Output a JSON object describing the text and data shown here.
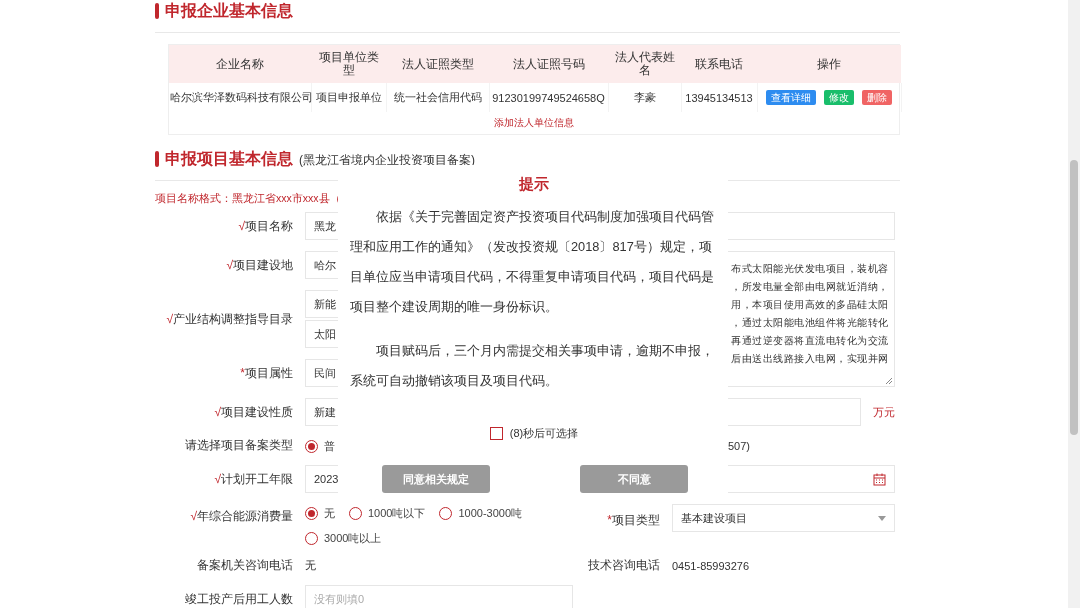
{
  "enterprise": {
    "title": "申报企业基本信息",
    "table": {
      "columns": [
        "企业名称",
        "项目单位类型",
        "法人证照类型",
        "法人证照号码",
        "法人代表姓名",
        "联系电话",
        "操作"
      ],
      "rows": [
        {
          "cells": [
            "哈尔滨华泽数码科技有限公司",
            "项目申报单位",
            "统一社会信用代码",
            "91230199749524658Q",
            "李豪",
            "13945134513"
          ],
          "actions": [
            {
              "label": "查看详细",
              "color": "#2d8cf0"
            },
            {
              "label": "修改",
              "color": "#19be6b"
            },
            {
              "label": "删除",
              "color": "#f06464"
            }
          ]
        }
      ],
      "add_link": "添加法人单位信息"
    }
  },
  "project": {
    "title": "申报项目基本信息",
    "subtitle": "(黑龙江省境内企业投资项目备案)",
    "hint": "项目名称格式：黑龙江省xxx市xxx县（",
    "description": {
      "lines": [
        "布式太阳能光伏发电项目，装机容",
        "，所发电量全部由电网就近消纳，",
        "用，本项目使用高效的多晶硅太阳",
        "，通过太阳能电池组件将光能转化",
        "再通过逆变器将直流电转化为交流",
        "后由送出线路接入电网，实现并网"
      ]
    },
    "rows": [
      {
        "mark": "√",
        "label": "项目名称",
        "kind": "wide_input",
        "value": "黑龙"
      },
      {
        "mark": "√",
        "label": "项目建设地",
        "kind": "input",
        "value": "哈尔"
      },
      {
        "mark": "√",
        "label": "产业结构调整指导目录",
        "kind": "double",
        "values": [
          "新能",
          "太阳"
        ]
      },
      {
        "mark": "*",
        "label": "项目属性",
        "kind": "input",
        "value": "民间"
      },
      {
        "mark": "√",
        "label": "项目建设性质",
        "kind": "input",
        "value": "新建",
        "right": {
          "kind": "unit_input",
          "unit": "万元"
        }
      },
      {
        "label": "请选择项目备案类型",
        "kind": "radio",
        "options": [
          {
            "label": "普",
            "selected": true
          }
        ],
        "right": {
          "kind": "note",
          "text": "507)"
        }
      },
      {
        "mark": "√",
        "label": "计划开工年限",
        "kind": "input",
        "value": "2023",
        "right": {
          "kind": "date"
        }
      },
      {
        "mark": "√",
        "label": "年综合能源消费量",
        "kind": "radio",
        "options": [
          {
            "label": "无",
            "selected": true
          },
          {
            "label": "1000吨以下",
            "selected": false
          },
          {
            "label": "1000-3000吨",
            "selected": false
          },
          {
            "label": "3000吨以上",
            "selected": false
          }
        ],
        "right": {
          "kind": "select",
          "mark": "*",
          "label": "项目类型",
          "value": "基本建设项目"
        }
      },
      {
        "label": "备案机关咨询电话",
        "kind": "text",
        "value": "无",
        "right": {
          "kind": "text",
          "label": "技术咨询电话",
          "value": "0451-85993276"
        }
      },
      {
        "label": "竣工投产后用工人数",
        "kind": "input",
        "placeholder": "没有则填0"
      }
    ]
  },
  "dialog": {
    "title": "提示",
    "paragraphs": [
      "依据《关于完善固定资产投资项目代码制度加强项目代码管理和应用工作的通知》（发改投资规〔2018〕817号）规定，项目单位应当申请项目代码，不得重复申请项目代码，项目代码是项目整个建设周期的唯一身份标识。",
      "项目赋码后，三个月内需提交相关事项申请，逾期不申报，系统可自动撤销该项目及项目代码。"
    ],
    "checkbox": {
      "label": "(8)秒后可选择",
      "checked": false
    },
    "buttons": [
      {
        "label": "同意相关规定",
        "disabled": true
      },
      {
        "label": "不同意",
        "disabled": true
      }
    ]
  }
}
